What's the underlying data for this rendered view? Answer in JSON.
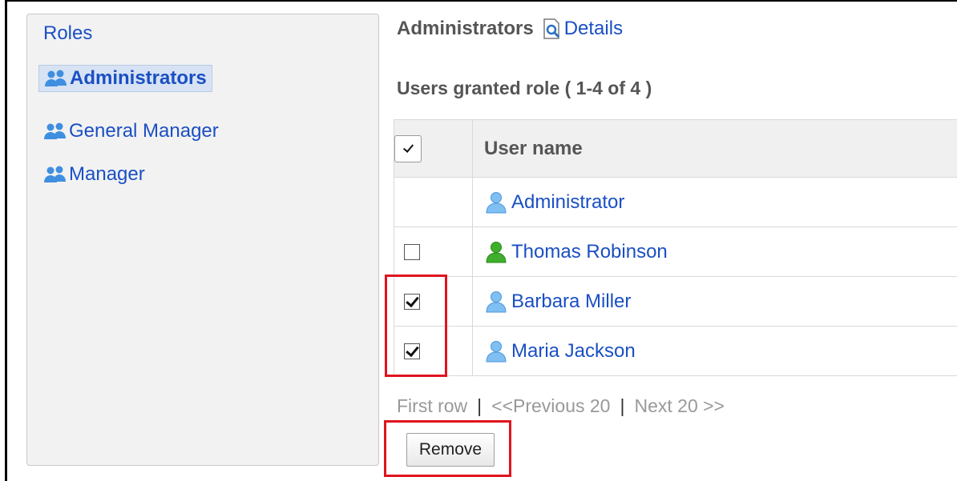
{
  "sidebar": {
    "title": "Roles",
    "roles": [
      {
        "label": "Administrators",
        "selected": true
      },
      {
        "label": "General Manager",
        "selected": false
      },
      {
        "label": "Manager",
        "selected": false
      }
    ]
  },
  "main": {
    "role_name": "Administrators",
    "details_label": "Details",
    "section_title": "Users granted role ( 1-4 of 4 )",
    "table": {
      "header_user": "User name",
      "rows": [
        {
          "name": "Administrator",
          "checkbox": "none",
          "icon": "user-icon-blue"
        },
        {
          "name": "Thomas Robinson",
          "checkbox": "unchecked",
          "icon": "user-icon-green"
        },
        {
          "name": "Barbara Miller",
          "checkbox": "checked",
          "icon": "user-icon-blue"
        },
        {
          "name": "Maria Jackson",
          "checkbox": "checked",
          "icon": "user-icon-blue"
        }
      ]
    },
    "pager": {
      "first": "First row",
      "separator": "|",
      "previous": "<<Previous 20",
      "next": "Next 20 >>"
    },
    "remove_label": "Remove"
  },
  "colors": {
    "link": "#1a4fc4",
    "highlight": "#e0141e",
    "user_blue": "#5aa3e8",
    "user_green": "#2e9e1f"
  }
}
